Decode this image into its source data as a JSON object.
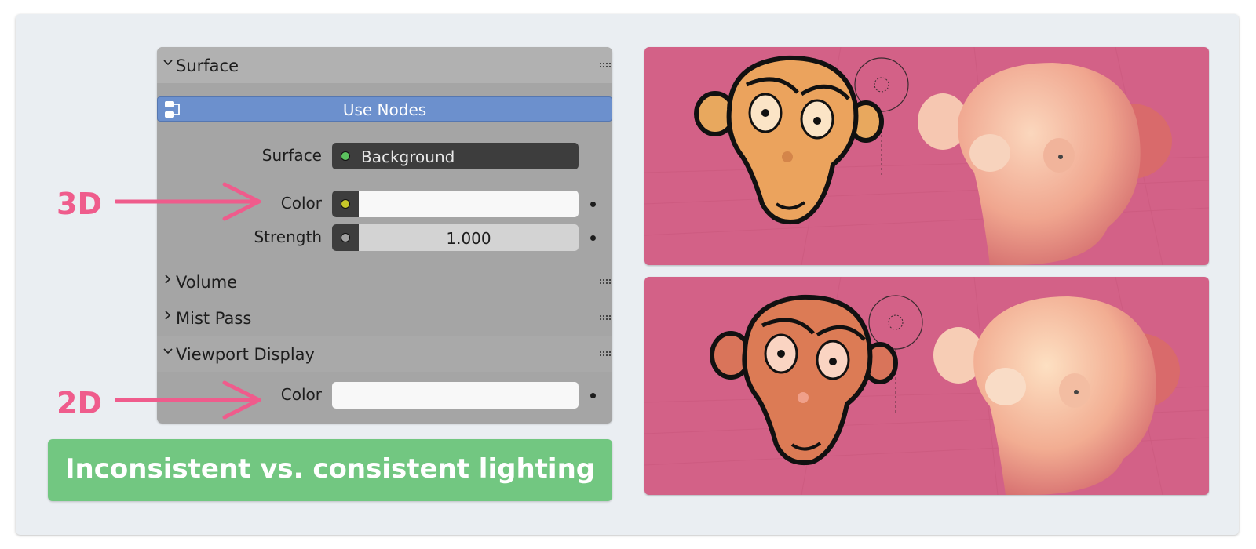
{
  "panel": {
    "surface_section": "Surface",
    "use_nodes": "Use Nodes",
    "surface_label": "Surface",
    "surface_value": "Background",
    "color_label": "Color",
    "strength_label": "Strength",
    "strength_value": "1.000",
    "volume_section": "Volume",
    "mist_section": "Mist Pass",
    "viewport_section": "Viewport Display",
    "viewport_color_label": "Color"
  },
  "annotations": {
    "label_3d": "3D",
    "label_2d": "2D"
  },
  "caption": "Inconsistent vs. consistent lighting",
  "colors": {
    "accent_pink": "#ef5c8c",
    "caption_green": "#72c781",
    "use_nodes_blue": "#6c90cd",
    "viewport_bg": "#d36187",
    "socket_green": "#5bc15e",
    "socket_yellow": "#c7c729",
    "socket_grey": "#a1a1a1"
  },
  "icons": {
    "collapse": "chevron-down-icon",
    "expand": "chevron-right-icon",
    "drag": "grip-icon",
    "nodes": "node-tree-icon"
  }
}
